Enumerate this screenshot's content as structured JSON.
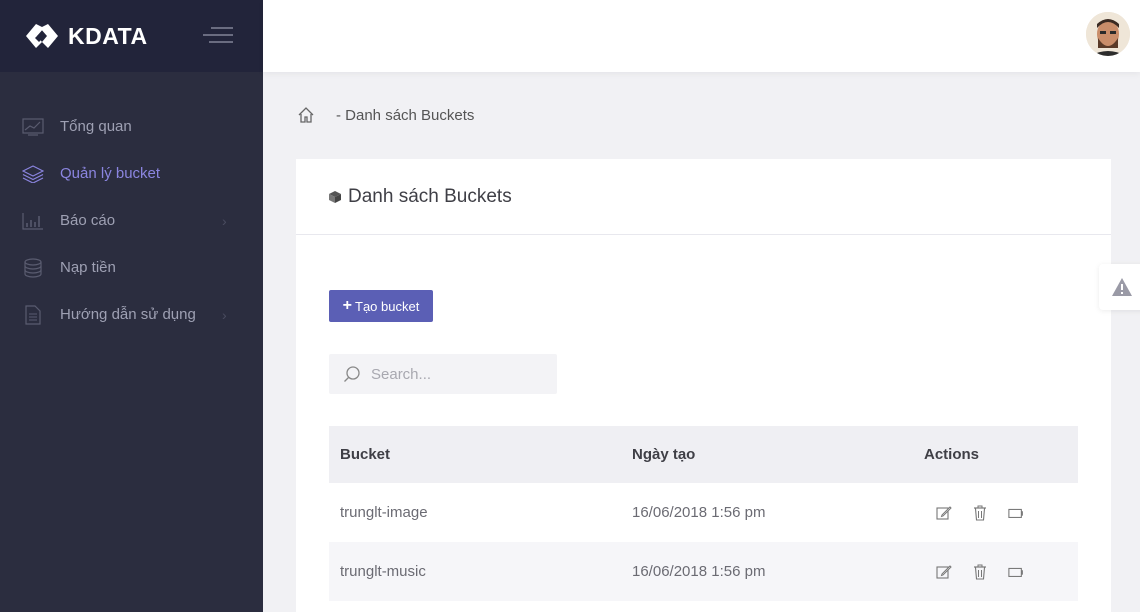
{
  "brand": {
    "name": "KDATA"
  },
  "sidebar": {
    "items": [
      {
        "label": "Tổng quan",
        "icon": "chart-monitor-icon",
        "active": false,
        "has_children": false
      },
      {
        "label": "Quản lý bucket",
        "icon": "layers-icon",
        "active": true,
        "has_children": false
      },
      {
        "label": "Báo cáo",
        "icon": "bar-chart-icon",
        "active": false,
        "has_children": true
      },
      {
        "label": "Nạp tiền",
        "icon": "coins-icon",
        "active": false,
        "has_children": false
      },
      {
        "label": "Hướng dẫn sử dụng",
        "icon": "document-icon",
        "active": false,
        "has_children": true
      }
    ]
  },
  "breadcrumb": {
    "text": "- Danh sách Buckets"
  },
  "card": {
    "title": "Danh sách Buckets",
    "create_button": "Tạo bucket",
    "search": {
      "placeholder": "Search...",
      "value": ""
    }
  },
  "table": {
    "columns": [
      "Bucket",
      "Ngày tạo",
      "Actions"
    ],
    "rows": [
      {
        "bucket": "trunglt-image",
        "date": "16/06/2018 1:56 pm"
      },
      {
        "bucket": "trunglt-music",
        "date": "16/06/2018 1:56 pm"
      }
    ]
  },
  "colors": {
    "sidebar_bg": "#2b2d3f",
    "accent": "#5b5fb5",
    "active_menu": "#8b85e0"
  }
}
